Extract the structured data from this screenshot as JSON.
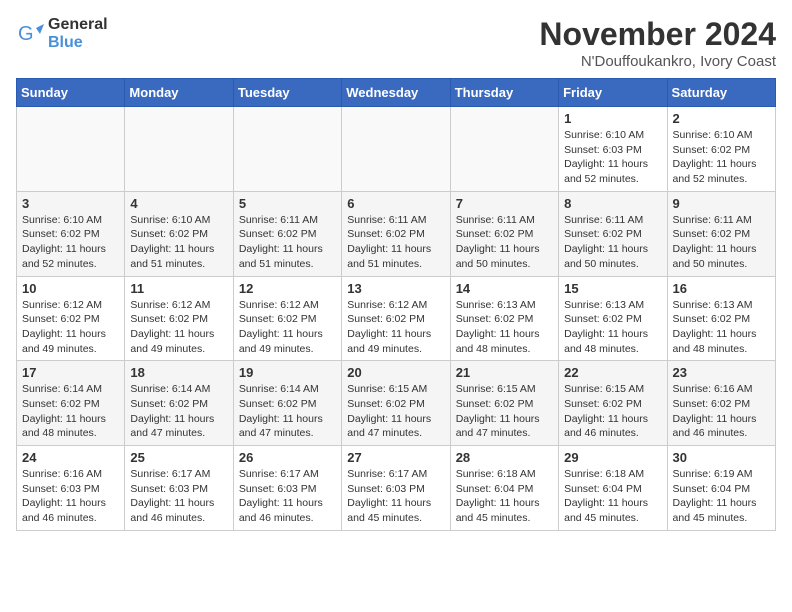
{
  "logo": {
    "general": "General",
    "blue": "Blue"
  },
  "title": "November 2024",
  "subtitle": "N'Douffoukankro, Ivory Coast",
  "header_days": [
    "Sunday",
    "Monday",
    "Tuesday",
    "Wednesday",
    "Thursday",
    "Friday",
    "Saturday"
  ],
  "weeks": [
    [
      {
        "day": "",
        "info": ""
      },
      {
        "day": "",
        "info": ""
      },
      {
        "day": "",
        "info": ""
      },
      {
        "day": "",
        "info": ""
      },
      {
        "day": "",
        "info": ""
      },
      {
        "day": "1",
        "info": "Sunrise: 6:10 AM\nSunset: 6:03 PM\nDaylight: 11 hours\nand 52 minutes."
      },
      {
        "day": "2",
        "info": "Sunrise: 6:10 AM\nSunset: 6:02 PM\nDaylight: 11 hours\nand 52 minutes."
      }
    ],
    [
      {
        "day": "3",
        "info": "Sunrise: 6:10 AM\nSunset: 6:02 PM\nDaylight: 11 hours\nand 52 minutes."
      },
      {
        "day": "4",
        "info": "Sunrise: 6:10 AM\nSunset: 6:02 PM\nDaylight: 11 hours\nand 51 minutes."
      },
      {
        "day": "5",
        "info": "Sunrise: 6:11 AM\nSunset: 6:02 PM\nDaylight: 11 hours\nand 51 minutes."
      },
      {
        "day": "6",
        "info": "Sunrise: 6:11 AM\nSunset: 6:02 PM\nDaylight: 11 hours\nand 51 minutes."
      },
      {
        "day": "7",
        "info": "Sunrise: 6:11 AM\nSunset: 6:02 PM\nDaylight: 11 hours\nand 50 minutes."
      },
      {
        "day": "8",
        "info": "Sunrise: 6:11 AM\nSunset: 6:02 PM\nDaylight: 11 hours\nand 50 minutes."
      },
      {
        "day": "9",
        "info": "Sunrise: 6:11 AM\nSunset: 6:02 PM\nDaylight: 11 hours\nand 50 minutes."
      }
    ],
    [
      {
        "day": "10",
        "info": "Sunrise: 6:12 AM\nSunset: 6:02 PM\nDaylight: 11 hours\nand 49 minutes."
      },
      {
        "day": "11",
        "info": "Sunrise: 6:12 AM\nSunset: 6:02 PM\nDaylight: 11 hours\nand 49 minutes."
      },
      {
        "day": "12",
        "info": "Sunrise: 6:12 AM\nSunset: 6:02 PM\nDaylight: 11 hours\nand 49 minutes."
      },
      {
        "day": "13",
        "info": "Sunrise: 6:12 AM\nSunset: 6:02 PM\nDaylight: 11 hours\nand 49 minutes."
      },
      {
        "day": "14",
        "info": "Sunrise: 6:13 AM\nSunset: 6:02 PM\nDaylight: 11 hours\nand 48 minutes."
      },
      {
        "day": "15",
        "info": "Sunrise: 6:13 AM\nSunset: 6:02 PM\nDaylight: 11 hours\nand 48 minutes."
      },
      {
        "day": "16",
        "info": "Sunrise: 6:13 AM\nSunset: 6:02 PM\nDaylight: 11 hours\nand 48 minutes."
      }
    ],
    [
      {
        "day": "17",
        "info": "Sunrise: 6:14 AM\nSunset: 6:02 PM\nDaylight: 11 hours\nand 48 minutes."
      },
      {
        "day": "18",
        "info": "Sunrise: 6:14 AM\nSunset: 6:02 PM\nDaylight: 11 hours\nand 47 minutes."
      },
      {
        "day": "19",
        "info": "Sunrise: 6:14 AM\nSunset: 6:02 PM\nDaylight: 11 hours\nand 47 minutes."
      },
      {
        "day": "20",
        "info": "Sunrise: 6:15 AM\nSunset: 6:02 PM\nDaylight: 11 hours\nand 47 minutes."
      },
      {
        "day": "21",
        "info": "Sunrise: 6:15 AM\nSunset: 6:02 PM\nDaylight: 11 hours\nand 47 minutes."
      },
      {
        "day": "22",
        "info": "Sunrise: 6:15 AM\nSunset: 6:02 PM\nDaylight: 11 hours\nand 46 minutes."
      },
      {
        "day": "23",
        "info": "Sunrise: 6:16 AM\nSunset: 6:02 PM\nDaylight: 11 hours\nand 46 minutes."
      }
    ],
    [
      {
        "day": "24",
        "info": "Sunrise: 6:16 AM\nSunset: 6:03 PM\nDaylight: 11 hours\nand 46 minutes."
      },
      {
        "day": "25",
        "info": "Sunrise: 6:17 AM\nSunset: 6:03 PM\nDaylight: 11 hours\nand 46 minutes."
      },
      {
        "day": "26",
        "info": "Sunrise: 6:17 AM\nSunset: 6:03 PM\nDaylight: 11 hours\nand 46 minutes."
      },
      {
        "day": "27",
        "info": "Sunrise: 6:17 AM\nSunset: 6:03 PM\nDaylight: 11 hours\nand 45 minutes."
      },
      {
        "day": "28",
        "info": "Sunrise: 6:18 AM\nSunset: 6:04 PM\nDaylight: 11 hours\nand 45 minutes."
      },
      {
        "day": "29",
        "info": "Sunrise: 6:18 AM\nSunset: 6:04 PM\nDaylight: 11 hours\nand 45 minutes."
      },
      {
        "day": "30",
        "info": "Sunrise: 6:19 AM\nSunset: 6:04 PM\nDaylight: 11 hours\nand 45 minutes."
      }
    ]
  ]
}
